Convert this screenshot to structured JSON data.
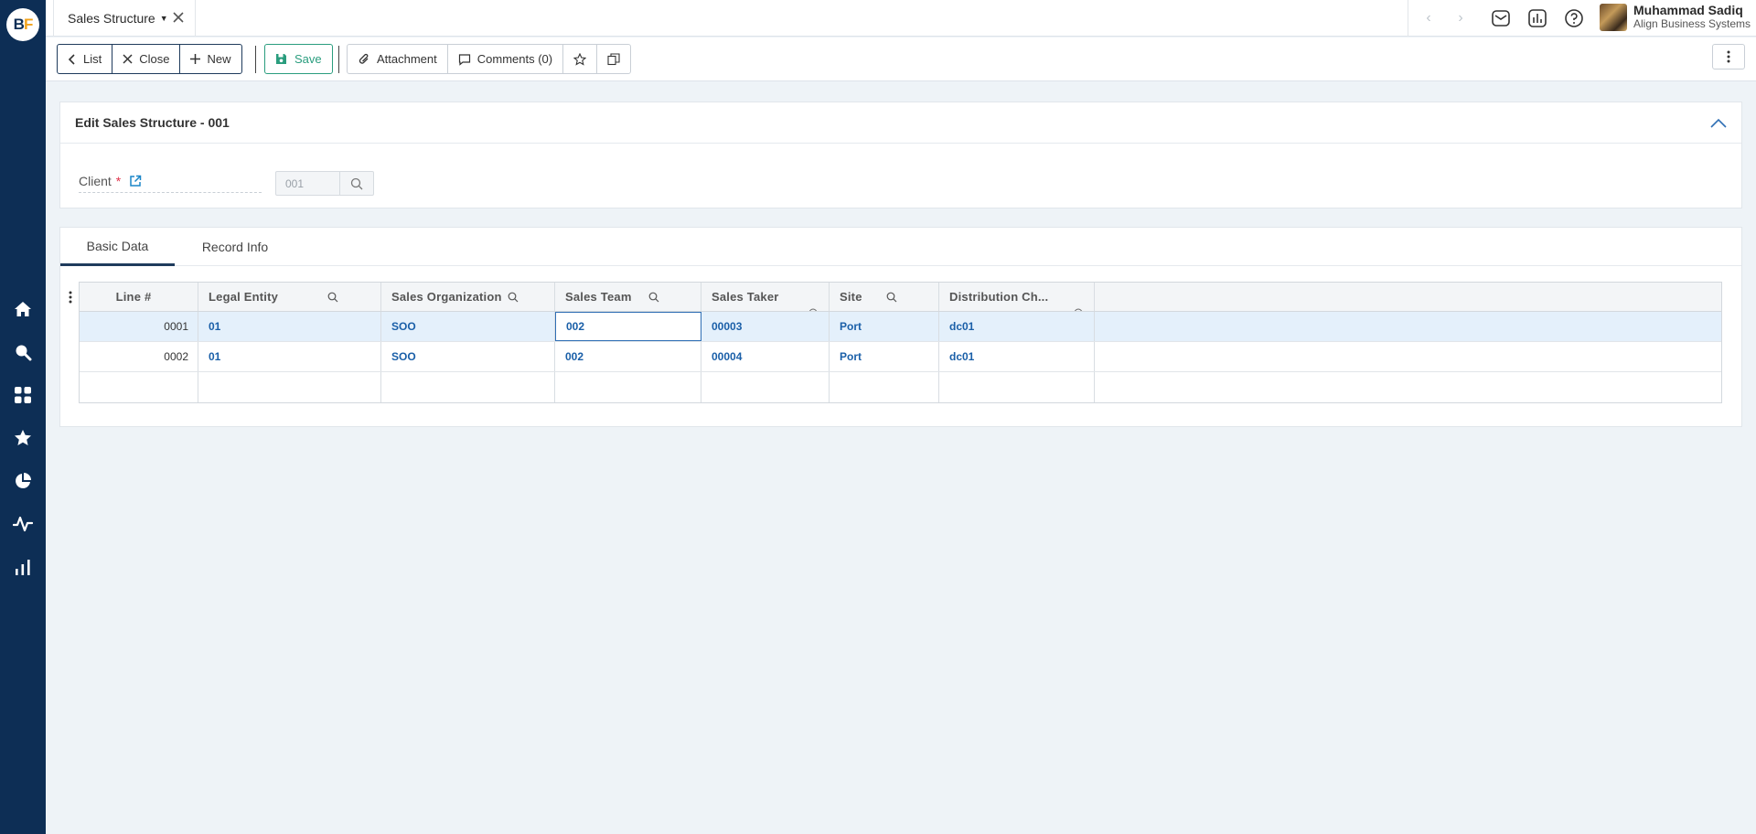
{
  "app": {
    "logo_text_b": "B",
    "logo_text_f": "F",
    "brand_color": "#0d2e55",
    "accent_color": "#f2a31b"
  },
  "sidebar": {
    "items": [
      {
        "icon": "home-icon"
      },
      {
        "icon": "search-icon"
      },
      {
        "icon": "apps-grid-icon"
      },
      {
        "icon": "star-icon"
      },
      {
        "icon": "pie-chart-icon"
      },
      {
        "icon": "activity-icon"
      },
      {
        "icon": "bar-chart-icon"
      }
    ]
  },
  "topbar": {
    "tab_title": "Sales Structure",
    "user_name": "Muhammad Sadiq",
    "user_org": "Align Business Systems"
  },
  "toolbar": {
    "list_label": "List",
    "close_label": "Close",
    "new_label": "New",
    "save_label": "Save",
    "attachment_label": "Attachment",
    "comments_label": "Comments (0)",
    "save_color": "#2a9d7e"
  },
  "header_card": {
    "title": "Edit Sales Structure - 001",
    "client_label": "Client",
    "required_mark": "*",
    "client_value": "001"
  },
  "tabs": [
    {
      "label": "Basic Data",
      "active": true
    },
    {
      "label": "Record Info",
      "active": false
    }
  ],
  "grid": {
    "columns": [
      "Line #",
      "Legal Entity",
      "Sales Organization",
      "Sales Team",
      "Sales Taker",
      "Site",
      "Distribution Ch..."
    ],
    "rows": [
      {
        "line": "0001",
        "legal_entity": "01",
        "sales_org": "SOO",
        "sales_team": "002",
        "sales_taker": "00003",
        "site": "Port",
        "dist_channel": "dc01"
      },
      {
        "line": "0002",
        "legal_entity": "01",
        "sales_org": "SOO",
        "sales_team": "002",
        "sales_taker": "00004",
        "site": "Port",
        "dist_channel": "dc01"
      }
    ],
    "link_color": "#1a5fa8"
  }
}
